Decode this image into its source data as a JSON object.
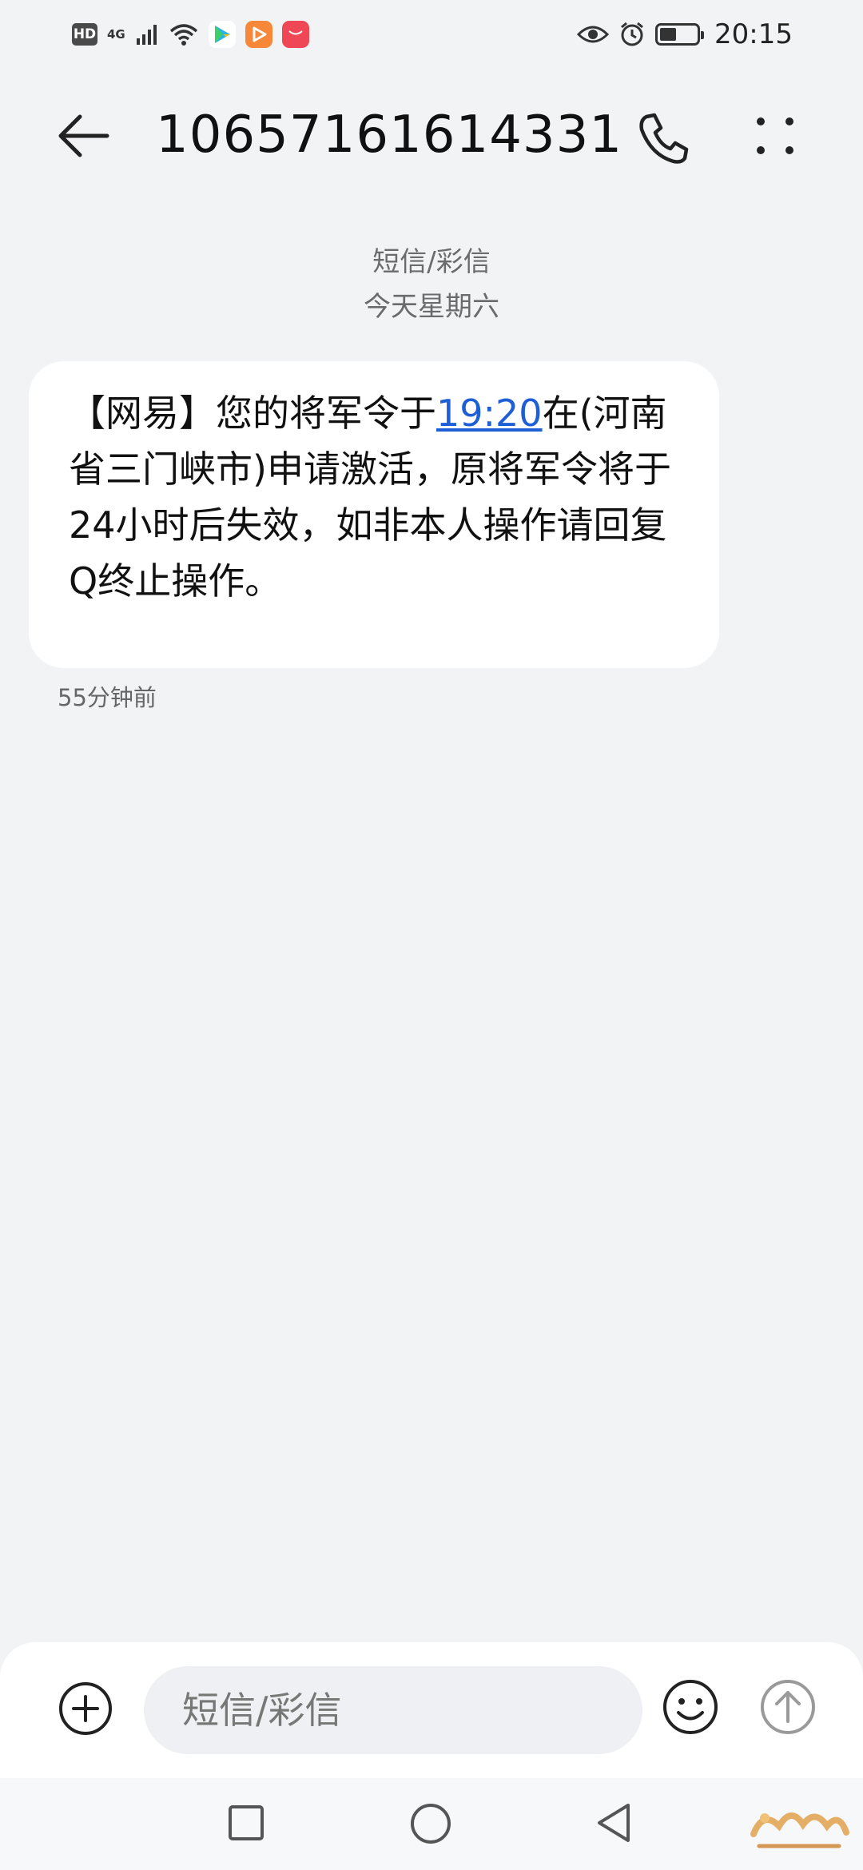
{
  "status_bar": {
    "hd_label": "HD",
    "network_label": "4G",
    "time": "20:15",
    "battery_level": 0.45
  },
  "header": {
    "contact_number": "10657161614331"
  },
  "thread": {
    "type_label": "短信/彩信",
    "date_label": "今天星期六"
  },
  "message": {
    "text_before_link": "【网易】您的将军令于",
    "link_text": "19:20",
    "text_after_link": "在(河南省三门峡市)申请激活，原将军令将于24小时后失效，如非本人操作请回复Q终止操作。",
    "time_ago": "55分钟前"
  },
  "composer": {
    "placeholder": "短信/彩信"
  },
  "colors": {
    "background": "#f1f3f5",
    "bubble": "#ffffff",
    "link": "#1e5fd6"
  }
}
